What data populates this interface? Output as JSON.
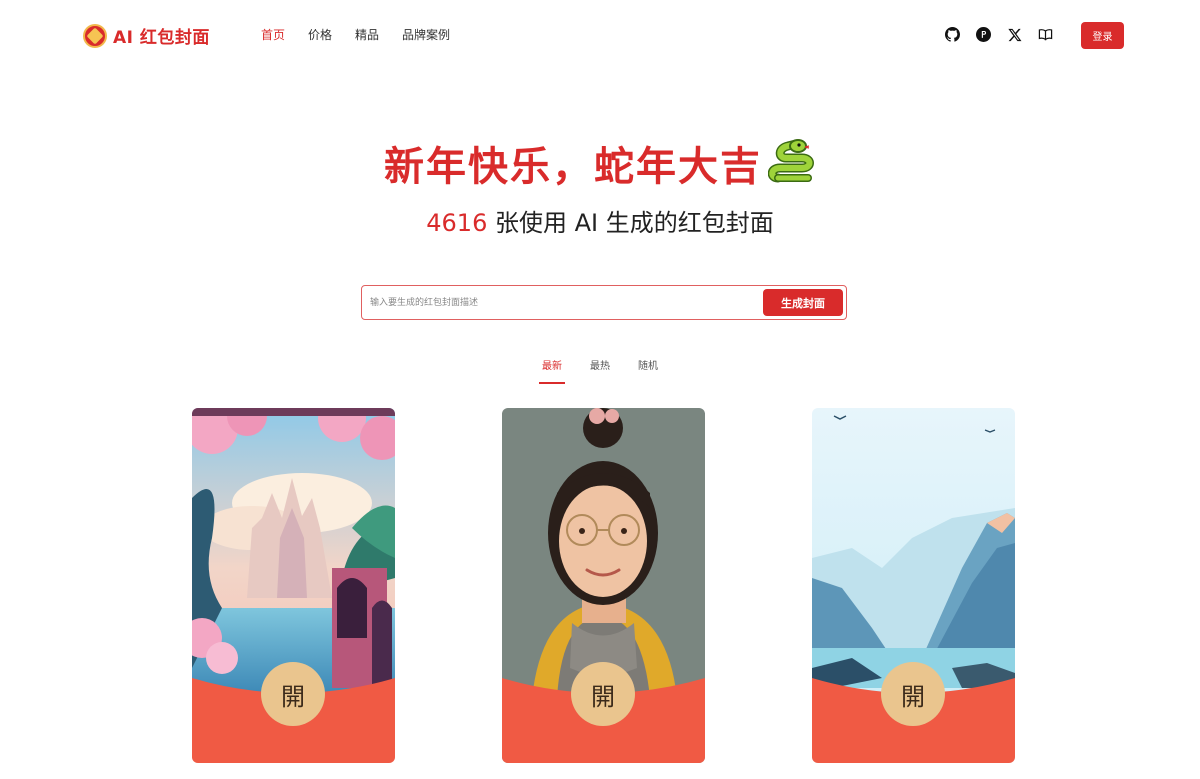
{
  "header": {
    "brand": "AI 红包封面",
    "nav": [
      "首页",
      "价格",
      "精品",
      "品牌案例"
    ],
    "icons": [
      "github-icon",
      "product-hunt-icon",
      "x-icon",
      "book-icon"
    ],
    "login_label": "登录"
  },
  "hero": {
    "title": "新年快乐，蛇年大吉",
    "title_emoji": "snake-icon",
    "count": "4616",
    "subtitle": " 张使用 AI 生成的红包封面"
  },
  "search": {
    "placeholder": "输入要生成的红包封面描述",
    "button_label": "生成封面"
  },
  "tabs": [
    {
      "label": "最新",
      "active": true
    },
    {
      "label": "最热",
      "active": false
    },
    {
      "label": "随机",
      "active": false
    }
  ],
  "cards": [
    {
      "art": "pastel fantasy castle with cherry blossoms and lake",
      "open_label": "開"
    },
    {
      "art": "smiling girl with glasses and scarf",
      "open_label": "開"
    },
    {
      "art": "blue mountain lake landscape",
      "open_label": "開"
    }
  ],
  "colors": {
    "accent": "#d92b2b",
    "envelope": "#f05a44",
    "open_button": "#eac58e"
  }
}
